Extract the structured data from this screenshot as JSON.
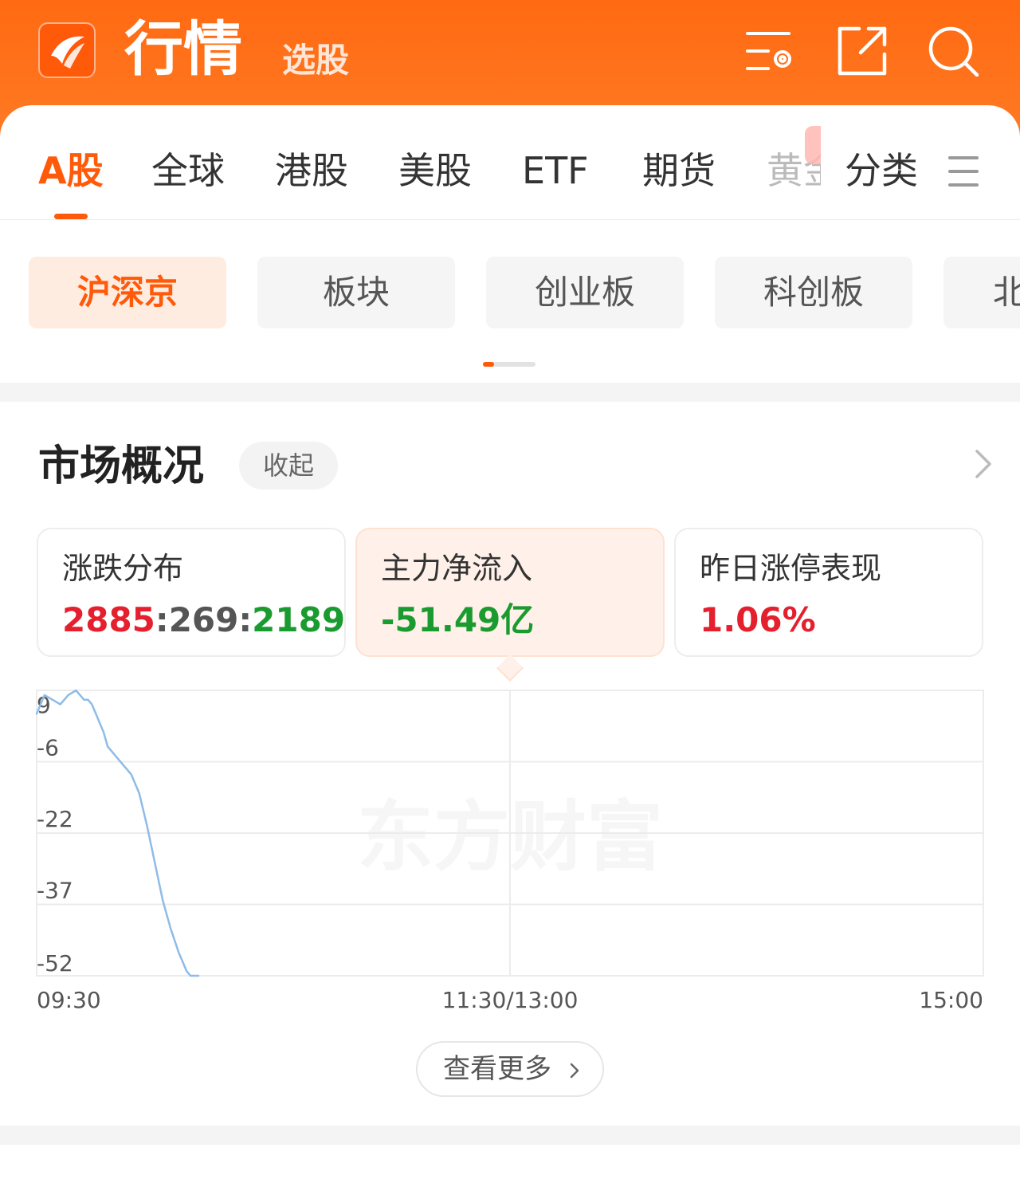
{
  "header": {
    "title": "行情",
    "subtitle": "选股",
    "icons": [
      "list-settings-icon",
      "share-icon",
      "search-icon"
    ],
    "accent": "#ff6a12"
  },
  "tabs": [
    {
      "label": "A股",
      "active": true
    },
    {
      "label": "全球"
    },
    {
      "label": "港股"
    },
    {
      "label": "美股"
    },
    {
      "label": "ETF"
    },
    {
      "label": "期货"
    },
    {
      "label": "黄金"
    },
    {
      "label": "分类"
    }
  ],
  "pills": [
    {
      "label": "沪深京",
      "active": true
    },
    {
      "label": "板块"
    },
    {
      "label": "创业板"
    },
    {
      "label": "科创板"
    },
    {
      "label": "北"
    }
  ],
  "overview": {
    "title": "市场概况",
    "collapse_label": "收起",
    "cards": [
      {
        "label": "涨跌分布",
        "up": "2885",
        "flat": "269",
        "down": "2189"
      },
      {
        "label": "主力净流入",
        "value": "-51.49亿",
        "active": true
      },
      {
        "label": "昨日涨停表现",
        "value": "1.06%"
      }
    ],
    "more_label": "查看更多",
    "watermark": "东方财富"
  },
  "chart_data": {
    "type": "line",
    "y_ticks": [
      "9",
      "-6",
      "-22",
      "-37",
      "-52"
    ],
    "x_ticks": [
      "09:30",
      "11:30/13:00",
      "15:00"
    ],
    "ylim": [
      -52,
      9
    ],
    "x_minutes_domain": [
      0,
      240
    ],
    "series": [
      {
        "color": "#8fbce6",
        "x_minutes": [
          0,
          2,
          4,
          6,
          8,
          10,
          11,
          12,
          13,
          14,
          15,
          16,
          17,
          18,
          20,
          22,
          24,
          26,
          28,
          30,
          32,
          34,
          36,
          37,
          38,
          39,
          40,
          41
        ],
        "values": [
          4,
          8,
          7,
          6,
          8,
          9,
          8,
          7,
          7,
          6,
          4,
          2,
          0,
          -3,
          -5,
          -7,
          -9,
          -13,
          -20,
          -28,
          -36,
          -42,
          -47,
          -49,
          -51,
          -52,
          -53,
          -53
        ]
      }
    ]
  }
}
